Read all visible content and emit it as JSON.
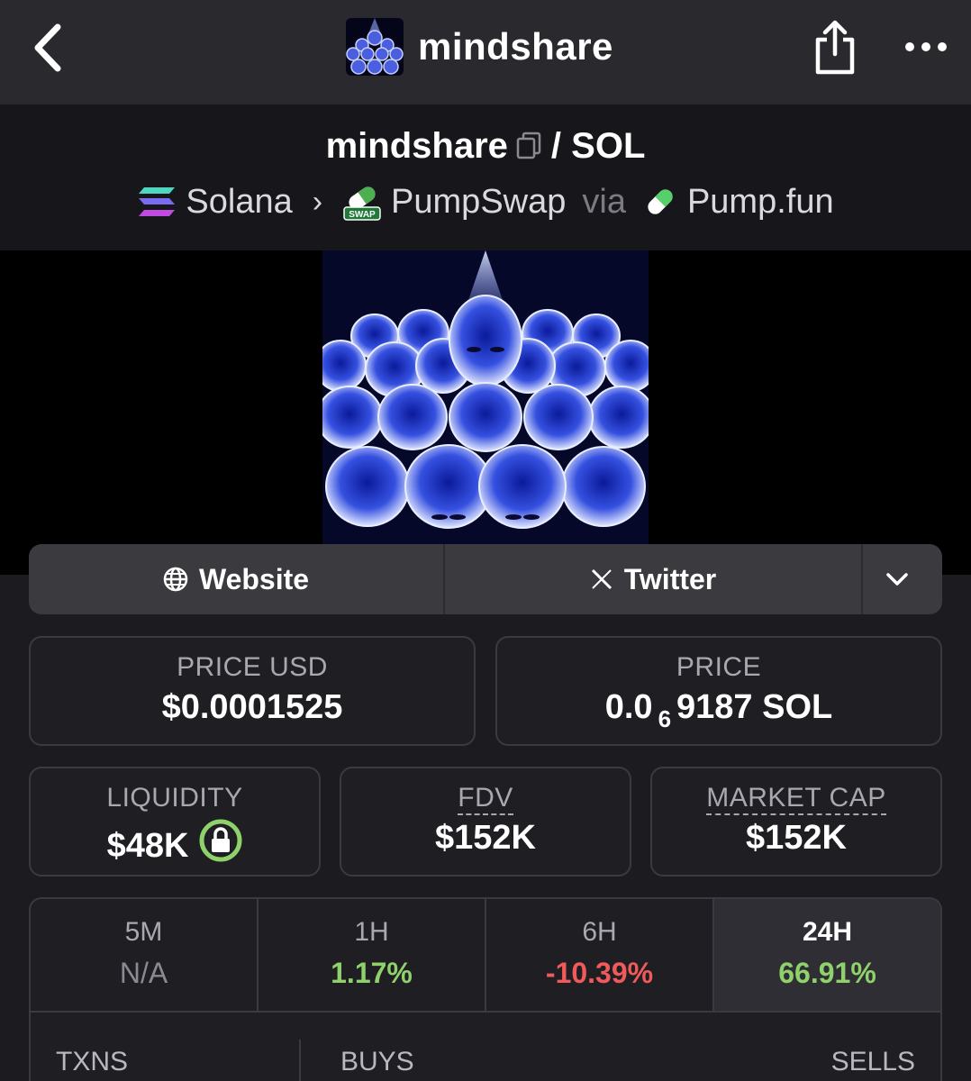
{
  "topbar": {
    "title": "mindshare",
    "icons": {
      "back": "chevron-left-icon",
      "share": "share-icon",
      "more": "more-icon"
    }
  },
  "pair": {
    "base": "mindshare",
    "separator": "/",
    "quote": "SOL"
  },
  "chain": {
    "network": "Solana",
    "dex": "PumpSwap",
    "via_label": "via",
    "launchpad": "Pump.fun"
  },
  "links": {
    "website": "Website",
    "twitter": "Twitter"
  },
  "stats": {
    "price_usd_label": "PRICE USD",
    "price_usd": "$0.0001525",
    "price_label": "PRICE",
    "price_sol_prefix": "0.0",
    "price_sol_sub": "6",
    "price_sol_rest": "9187 SOL",
    "liquidity_label": "LIQUIDITY",
    "liquidity": "$48K",
    "fdv_label": "FDV",
    "fdv": "$152K",
    "mcap_label": "MARKET CAP",
    "mcap": "$152K"
  },
  "changes": [
    {
      "label": "5M",
      "value": "N/A"
    },
    {
      "label": "1H",
      "value": "1.17%"
    },
    {
      "label": "6H",
      "value": "-10.39%"
    },
    {
      "label": "24H",
      "value": "66.91%"
    }
  ],
  "txns": {
    "txns_label": "TXNS",
    "buys_label": "BUYS",
    "sells_label": "SELLS"
  },
  "colors": {
    "positive": "#8fd16a",
    "negative": "#f05a5a",
    "liquidity_lock": "#8fd16a"
  }
}
